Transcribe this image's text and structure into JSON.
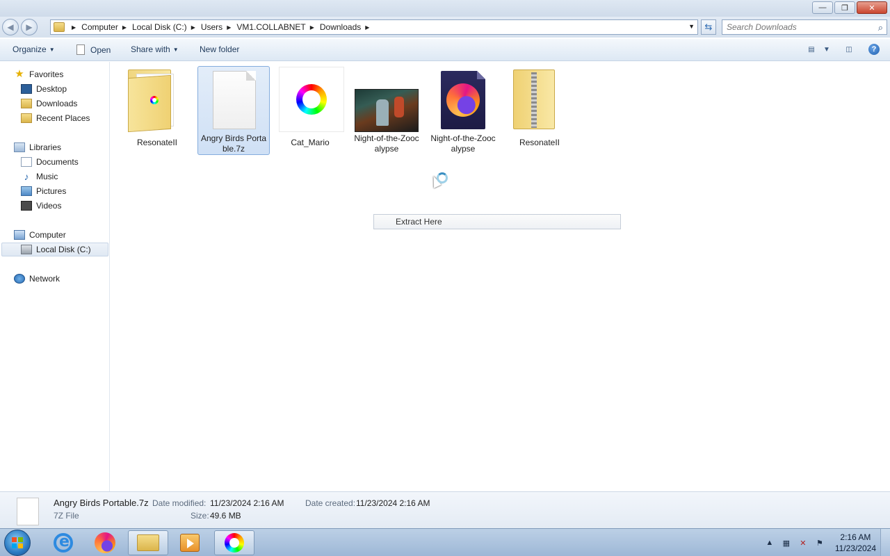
{
  "window": {
    "controls": {
      "minimize": "—",
      "maximize": "❐",
      "close": "✕"
    }
  },
  "address": {
    "breadcrumbs": [
      "Computer",
      "Local Disk (C:)",
      "Users",
      "VM1.COLLABNET",
      "Downloads"
    ],
    "search_placeholder": "Search Downloads"
  },
  "toolbar": {
    "organize": "Organize",
    "open": "Open",
    "share_with": "Share with",
    "new_folder": "New folder"
  },
  "sidebar": {
    "favorites": {
      "label": "Favorites",
      "items": [
        "Desktop",
        "Downloads",
        "Recent Places"
      ]
    },
    "libraries": {
      "label": "Libraries",
      "items": [
        "Documents",
        "Music",
        "Pictures",
        "Videos"
      ]
    },
    "computer": {
      "label": "Computer",
      "items": [
        "Local Disk (C:)"
      ]
    },
    "network": {
      "label": "Network"
    }
  },
  "files": [
    {
      "name": "ResonateII",
      "kind": "folder"
    },
    {
      "name": "Angry Birds Portable.7z",
      "kind": "7z",
      "selected": true
    },
    {
      "name": "Cat_Mario",
      "kind": "image"
    },
    {
      "name": "Night-of-the-Zoocalypse",
      "kind": "video"
    },
    {
      "name": "Night-of-the-Zoocalypse",
      "kind": "firefox-html"
    },
    {
      "name": "ResonateII",
      "kind": "zip"
    }
  ],
  "context_menu": {
    "item": "Extract Here"
  },
  "details": {
    "file_name": "Angry Birds Portable.7z",
    "file_type": "7Z File",
    "date_modified_label": "Date modified:",
    "date_modified": "11/23/2024 2:16 AM",
    "date_created_label": "Date created:",
    "date_created": "11/23/2024 2:16 AM",
    "size_label": "Size:",
    "size": "49.6 MB"
  },
  "taskbar": {
    "apps": [
      "internet-explorer-icon",
      "firefox-icon",
      "windows-explorer-icon",
      "media-player-icon",
      "color-ring-app-icon"
    ],
    "clock_time": "2:16 AM",
    "clock_date": "11/23/2024"
  }
}
